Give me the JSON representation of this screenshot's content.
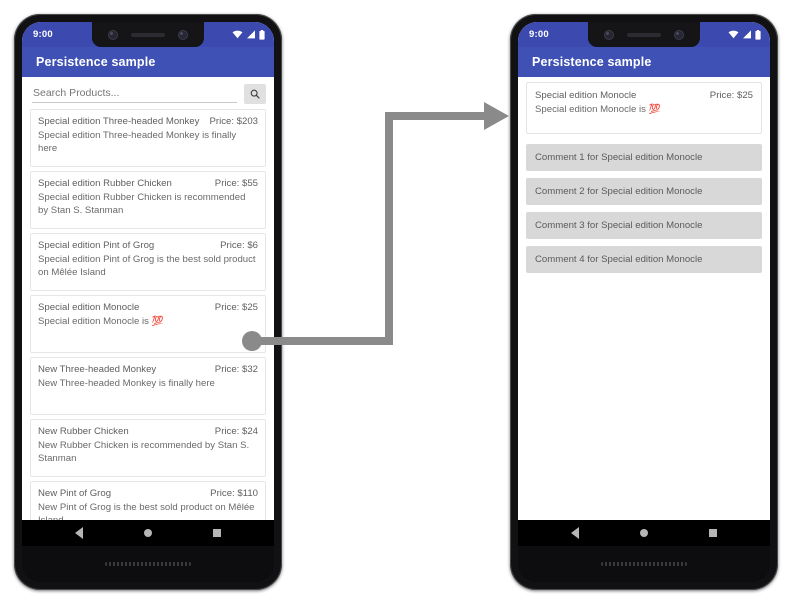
{
  "app": {
    "title": "Persistence sample",
    "brand_color": "#3f51b5",
    "status_bar_color": "#3c4ab0"
  },
  "status_bar": {
    "clock": "9:00",
    "icons": [
      "wifi-icon",
      "signal-icon",
      "battery-icon"
    ]
  },
  "nav_bar": {
    "back": "back-nav-icon",
    "home": "home-nav-icon",
    "recents": "recents-nav-icon"
  },
  "left_phone": {
    "search": {
      "value": "",
      "placeholder": "Search Products...",
      "button_icon": "search-icon"
    },
    "products": [
      {
        "title": "Special edition Three-headed Monkey",
        "price": "Price: $203",
        "description": "Special edition Three-headed Monkey is finally here",
        "emoji": ""
      },
      {
        "title": "Special edition Rubber Chicken",
        "price": "Price: $55",
        "description": "Special edition Rubber Chicken is recommended by Stan S. Stanman",
        "emoji": ""
      },
      {
        "title": "Special edition Pint of Grog",
        "price": "Price: $6",
        "description": "Special edition Pint of Grog is the best sold product on Mêlée Island",
        "emoji": ""
      },
      {
        "title": "Special edition Monocle",
        "price": "Price: $25",
        "description": "Special edition Monocle is ",
        "emoji": "💯"
      },
      {
        "title": "New Three-headed Monkey",
        "price": "Price: $32",
        "description": "New Three-headed Monkey is finally here",
        "emoji": ""
      },
      {
        "title": "New Rubber Chicken",
        "price": "Price: $24",
        "description": "New Rubber Chicken is recommended by Stan S. Stanman",
        "emoji": ""
      },
      {
        "title": "New Pint of Grog",
        "price": "Price: $110",
        "description": "New Pint of Grog is the best sold product on Mêlée Island",
        "emoji": ""
      }
    ]
  },
  "right_phone": {
    "detail": {
      "title": "Special edition Monocle",
      "price": "Price: $25",
      "description": "Special edition Monocle is ",
      "emoji": "💯"
    },
    "comments": [
      "Comment 1 for Special edition Monocle",
      "Comment 2 for Special edition Monocle",
      "Comment 3 for Special edition Monocle",
      "Comment 4 for Special edition Monocle"
    ]
  },
  "annotation": {
    "connector_color": "#8a8a8a",
    "source_name": "selected-product-monocle",
    "target_name": "product-detail-screen"
  }
}
